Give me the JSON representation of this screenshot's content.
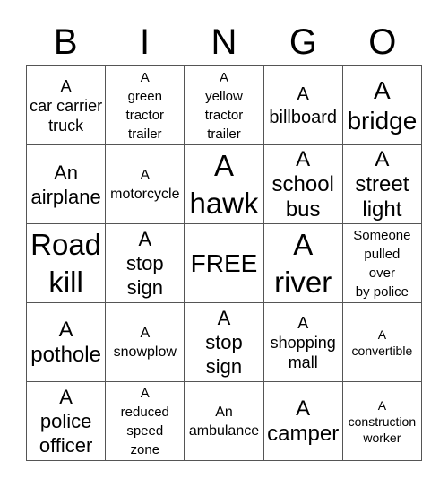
{
  "header": {
    "letters": [
      "B",
      "I",
      "N",
      "G",
      "O"
    ]
  },
  "cells": [
    {
      "text": "A\ncar carrier\ntruck"
    },
    {
      "text": "A\ngreen\ntractor\ntrailer"
    },
    {
      "text": "A\nyellow\ntractor\ntrailer"
    },
    {
      "text": "A\nbillboard"
    },
    {
      "text": "A\nbridge"
    },
    {
      "text": "An\nairplane"
    },
    {
      "text": "A\nmotorcycle"
    },
    {
      "text": "A\nhawk"
    },
    {
      "text": "A\nschool\nbus"
    },
    {
      "text": "A\nstreet\nlight"
    },
    {
      "text": "Road\nkill"
    },
    {
      "text": "A\nstop\nsign"
    },
    {
      "text": "FREE"
    },
    {
      "text": "A\nriver"
    },
    {
      "text": "Someone\npulled\nover\nby police"
    },
    {
      "text": "A\npothole"
    },
    {
      "text": "A\nsnowplow"
    },
    {
      "text": "A\nstop\nsign"
    },
    {
      "text": "A\nshopping\nmall"
    },
    {
      "text": "A\nconvertible"
    },
    {
      "text": "A\npolice\nofficer"
    },
    {
      "text": "A\nreduced\nspeed\nzone"
    },
    {
      "text": "An\nambulance"
    },
    {
      "text": "A\ncamper"
    },
    {
      "text": "A\nconstruction\nworker"
    }
  ]
}
